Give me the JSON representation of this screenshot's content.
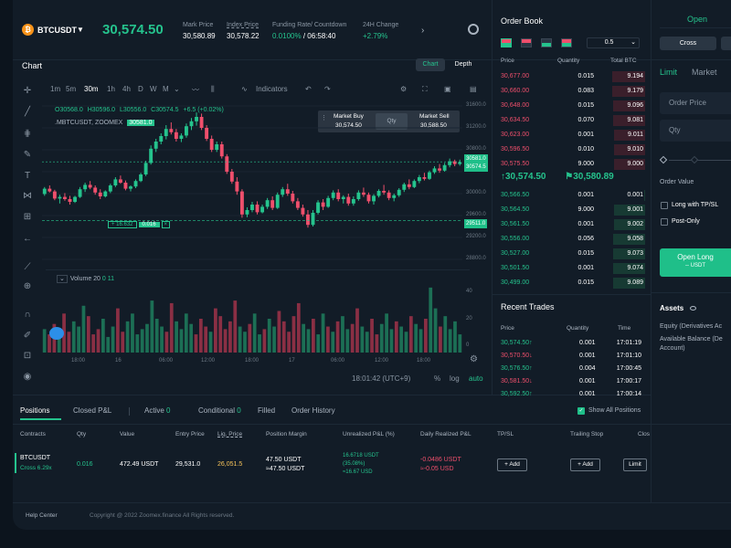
{
  "header": {
    "symbol": "BTCUSDT",
    "last_price": "30,574.50",
    "stats": [
      {
        "label": "Mark Price",
        "value": "30,580.89"
      },
      {
        "label": "Index Price",
        "value": "30,578.22"
      },
      {
        "label": "Funding Rate/ Countdown",
        "value_a": "0.0100%",
        "value_b": "/ 06:58:40"
      },
      {
        "label": "24H Change",
        "value": "+2.79%"
      }
    ]
  },
  "chart": {
    "title": "Chart",
    "view_tabs": [
      "Chart",
      "Depth"
    ],
    "timeframes": [
      "1m",
      "5m",
      "30m",
      "1h",
      "4h",
      "D",
      "W",
      "M"
    ],
    "active_timeframe": "30m",
    "indicators_label": "Indicators",
    "ohlc": {
      "o": "O30568.0",
      "h": "H30596.0",
      "l": "L30556.0",
      "c": "C30574.5",
      "chg": "+6.5 (+0.02%)"
    },
    "index_line": {
      "name": ".MBTCUSDT, ZOOMEX",
      "value": "30581.0"
    },
    "market_buy": {
      "label": "Market Buy",
      "value": "30,574.50"
    },
    "qty_label": "Qty",
    "market_sell": {
      "label": "Market Sell",
      "value": "30,588.50"
    },
    "position_tag": {
      "pnl": "+ 16.632",
      "qty": "0.016",
      "close": "×"
    },
    "price_axis": [
      "31600.0",
      "31200.0",
      "30800.0",
      "30400.0",
      "30000.0",
      "29600.0",
      "29200.0",
      "28800.0"
    ],
    "price_tags": [
      {
        "value": "30581.0",
        "kind": "index"
      },
      {
        "value": "30574.5",
        "kind": "last"
      },
      {
        "value": "29511.0",
        "kind": "entry"
      }
    ],
    "volume_label": {
      "name": "Volume 20",
      "v1": "0",
      "v2": "11"
    },
    "volume_axis": [
      "40",
      "20",
      "0"
    ],
    "time_axis": [
      "18:00",
      "16",
      "06:00",
      "12:00",
      "18:00",
      "17",
      "06:00",
      "12:00",
      "18:00"
    ],
    "clock": "18:01:42 (UTC+9)",
    "scale_opts": [
      "%",
      "log",
      "auto"
    ],
    "candles": [
      [
        29993,
        30120,
        29960,
        30090
      ],
      [
        30090,
        30150,
        30020,
        30040
      ],
      [
        30040,
        30070,
        29880,
        29910
      ],
      [
        29910,
        29980,
        29820,
        29940
      ],
      [
        29940,
        30010,
        29870,
        29900
      ],
      [
        29900,
        29960,
        29800,
        29850
      ],
      [
        29850,
        29960,
        29830,
        29940
      ],
      [
        29940,
        30120,
        29920,
        30080
      ],
      [
        30080,
        30200,
        30030,
        30160
      ],
      [
        30160,
        30230,
        30080,
        30110
      ],
      [
        30110,
        30150,
        29980,
        30020
      ],
      [
        30020,
        30080,
        29900,
        29950
      ],
      [
        29950,
        30060,
        29930,
        30040
      ],
      [
        30040,
        30180,
        30010,
        30150
      ],
      [
        30150,
        30300,
        30120,
        30260
      ],
      [
        30260,
        30330,
        30180,
        30200
      ],
      [
        30200,
        30240,
        30060,
        30090
      ],
      [
        30090,
        30150,
        30040,
        30130
      ],
      [
        30130,
        30260,
        30100,
        30230
      ],
      [
        30230,
        30380,
        30210,
        30350
      ],
      [
        30350,
        30600,
        30320,
        30560
      ],
      [
        30560,
        30880,
        30530,
        30820
      ],
      [
        30820,
        31000,
        30760,
        30950
      ],
      [
        30950,
        31100,
        30900,
        31050
      ],
      [
        31050,
        31250,
        30990,
        31180
      ],
      [
        31180,
        31300,
        31080,
        31120
      ],
      [
        31120,
        31180,
        30950,
        31000
      ],
      [
        31000,
        31100,
        30940,
        31060
      ],
      [
        31060,
        31280,
        31020,
        31230
      ],
      [
        31230,
        31380,
        31160,
        31320
      ],
      [
        31320,
        31480,
        31240,
        31400
      ],
      [
        31400,
        31460,
        31160,
        31200
      ],
      [
        31200,
        31250,
        30960,
        31000
      ],
      [
        31000,
        31060,
        30760,
        30800
      ],
      [
        30800,
        30950,
        30760,
        30900
      ],
      [
        30900,
        30950,
        30640,
        30680
      ],
      [
        30680,
        30720,
        30360,
        30400
      ],
      [
        30400,
        30450,
        30180,
        30220
      ],
      [
        30220,
        30300,
        29980,
        30040
      ],
      [
        30040,
        30080,
        29560,
        29620
      ],
      [
        29620,
        29750,
        29570,
        29700
      ],
      [
        29700,
        29850,
        29660,
        29800
      ],
      [
        29800,
        29860,
        29620,
        29660
      ],
      [
        29660,
        29800,
        29640,
        29760
      ],
      [
        29760,
        29920,
        29720,
        29880
      ],
      [
        29880,
        29950,
        29700,
        29740
      ],
      [
        29740,
        30020,
        29720,
        29980
      ],
      [
        29980,
        30120,
        29940,
        30080
      ],
      [
        30080,
        30180,
        29960,
        30000
      ],
      [
        30000,
        30050,
        29820,
        29860
      ],
      [
        29860,
        29920,
        29700,
        29740
      ],
      [
        29740,
        29800,
        29580,
        29620
      ],
      [
        29620,
        29700,
        29380,
        29430
      ],
      [
        29430,
        29700,
        29400,
        29650
      ],
      [
        29650,
        29880,
        29620,
        29840
      ],
      [
        29840,
        29900,
        29700,
        29760
      ],
      [
        29760,
        29960,
        29740,
        29920
      ],
      [
        29920,
        30060,
        29880,
        30020
      ],
      [
        30020,
        30080,
        29860,
        29900
      ],
      [
        29900,
        29970,
        29820,
        29940
      ],
      [
        29940,
        30000,
        29780,
        29820
      ],
      [
        29820,
        29950,
        29780,
        29900
      ],
      [
        29900,
        30060,
        29870,
        30020
      ],
      [
        30020,
        30110,
        29940,
        29980
      ],
      [
        29980,
        30020,
        29820,
        29860
      ],
      [
        29860,
        29990,
        29800,
        29960
      ],
      [
        29960,
        30080,
        29930,
        30050
      ],
      [
        30050,
        30160,
        29980,
        30020
      ],
      [
        30020,
        30060,
        29880,
        29920
      ],
      [
        29920,
        30000,
        29860,
        29970
      ],
      [
        29970,
        30100,
        29940,
        30070
      ],
      [
        30070,
        30200,
        30030,
        30170
      ],
      [
        30170,
        30260,
        30080,
        30120
      ],
      [
        30120,
        30260,
        30100,
        30230
      ],
      [
        30230,
        30340,
        30190,
        30300
      ],
      [
        30300,
        30380,
        30240,
        30270
      ],
      [
        30270,
        30420,
        30250,
        30390
      ],
      [
        30390,
        30500,
        30360,
        30460
      ],
      [
        30460,
        30540,
        30380,
        30420
      ],
      [
        30420,
        30560,
        30400,
        30520
      ],
      [
        30520,
        30640,
        30480,
        30590
      ],
      [
        30590,
        30620,
        30500,
        30540
      ],
      [
        30540,
        30620,
        30510,
        30574
      ]
    ],
    "volumes": [
      18,
      14,
      22,
      12,
      30,
      16,
      24,
      20,
      36,
      28,
      14,
      18,
      26,
      12,
      20,
      34,
      16,
      24,
      30,
      14,
      18,
      22,
      40,
      26,
      20,
      16,
      38,
      24,
      18,
      30,
      22,
      14,
      26,
      20,
      16,
      34,
      28,
      18,
      24,
      40,
      20,
      16,
      22,
      30,
      14,
      18,
      26,
      20,
      32,
      24,
      16,
      28,
      38,
      22,
      18,
      26,
      14,
      30,
      20,
      16,
      24,
      28,
      18,
      22,
      34,
      20,
      16,
      26,
      14,
      22,
      30,
      18,
      24,
      20,
      16,
      28,
      22,
      18,
      26,
      50,
      34,
      20,
      28,
      18,
      24,
      14
    ]
  },
  "orderbook": {
    "title": "Order Book",
    "step": "0.5",
    "columns": [
      "Price",
      "Quantity",
      "Total BTC"
    ],
    "asks": [
      {
        "price": "30,677.00",
        "qty": "0.015",
        "total": "9.194",
        "depth": 0.95
      },
      {
        "price": "30,660.00",
        "qty": "0.083",
        "total": "9.179",
        "depth": 0.94
      },
      {
        "price": "30,648.00",
        "qty": "0.015",
        "total": "9.096",
        "depth": 0.92
      },
      {
        "price": "30,634.50",
        "qty": "0.070",
        "total": "9.081",
        "depth": 0.91
      },
      {
        "price": "30,623.00",
        "qty": "0.001",
        "total": "9.011",
        "depth": 0.9
      },
      {
        "price": "30,596.50",
        "qty": "0.010",
        "total": "9.010",
        "depth": 0.9
      },
      {
        "price": "30,575.50",
        "qty": "9.000",
        "total": "9.000",
        "depth": 0.9
      }
    ],
    "mid_last": "30,574.50",
    "mid_mark": "30,580.89",
    "bids": [
      {
        "price": "30,566.50",
        "qty": "0.001",
        "total": "0.001",
        "depth": 0.03
      },
      {
        "price": "30,564.50",
        "qty": "9.000",
        "total": "9.001",
        "depth": 0.9
      },
      {
        "price": "30,561.50",
        "qty": "0.001",
        "total": "9.002",
        "depth": 0.9
      },
      {
        "price": "30,556.00",
        "qty": "0.056",
        "total": "9.058",
        "depth": 0.91
      },
      {
        "price": "30,527.00",
        "qty": "0.015",
        "total": "9.073",
        "depth": 0.91
      },
      {
        "price": "30,501.50",
        "qty": "0.001",
        "total": "9.074",
        "depth": 0.91
      },
      {
        "price": "30,499.00",
        "qty": "0.015",
        "total": "9.089",
        "depth": 0.92
      }
    ]
  },
  "recent_trades": {
    "title": "Recent Trades",
    "columns": [
      "Price",
      "Quantity",
      "Time"
    ],
    "rows": [
      {
        "price": "30,574.50",
        "dir": "up",
        "qty": "0.001",
        "time": "17:01:19"
      },
      {
        "price": "30,570.50",
        "dir": "down",
        "qty": "0.001",
        "time": "17:01:10"
      },
      {
        "price": "30,576.50",
        "dir": "up",
        "qty": "0.004",
        "time": "17:00:45"
      },
      {
        "price": "30,581.50",
        "dir": "down",
        "qty": "0.001",
        "time": "17:00:17"
      },
      {
        "price": "30,592.50",
        "dir": "up",
        "qty": "0.001",
        "time": "17:00:14"
      }
    ]
  },
  "order_panel": {
    "title": "Open",
    "margin_mode": "Cross",
    "tabs": [
      "Limit",
      "Market"
    ],
    "order_price_placeholder": "Order Price",
    "qty_placeholder": "Qty",
    "order_value_label": "Order Value",
    "tpsl_label": "Long with TP/SL",
    "post_only_label": "Post-Only",
    "open_long": "Open Long",
    "open_long_unit": "-- USDT",
    "assets_title": "Assets",
    "equity_label": "Equity (Derivatives Ac",
    "avail_label_1": "Available Balance (De",
    "avail_label_2": "Account)"
  },
  "positions": {
    "tabs": [
      {
        "label": "Positions",
        "count": ""
      },
      {
        "label": "Closed P&L",
        "count": ""
      },
      {
        "label": "Active",
        "count": "0"
      },
      {
        "label": "Conditional",
        "count": "0"
      },
      {
        "label": "Filled",
        "count": ""
      },
      {
        "label": "Order History",
        "count": ""
      }
    ],
    "show_all": "Show All Positions",
    "columns": [
      "Contracts",
      "Qty",
      "Value",
      "Entry Price",
      "Liq. Price",
      "Position Margin",
      "Unrealized P&L (%)",
      "Daily Realized P&L",
      "TP/SL",
      "Trailing Stop",
      "Clos"
    ],
    "row": {
      "contract": "BTCUSDT",
      "leverage": "Cross 6.29x",
      "qty": "0.016",
      "value": "472.49 USDT",
      "entry": "29,531.0",
      "liq": "26,051.5",
      "margin_a": "47.50 USDT",
      "margin_b": "≈47.50 USDT",
      "upnl_a": "16.6718 USDT",
      "upnl_b": "(35.08%)",
      "upnl_c": "≈16.67 USD",
      "drpnl_a": "-0.0486 USDT",
      "drpnl_b": "≈-0.05 USD",
      "tpsl_btn": "+ Add",
      "trailing_btn": "+ Add",
      "limit_btn": "Limit"
    }
  },
  "footer": {
    "help": "Help Center",
    "copyright": "Copyright @ 2022 Zoomex.finance All Rights reserved."
  },
  "colors": {
    "green": "#25c38d",
    "red": "#ef4f6c",
    "bg": "#121c27"
  }
}
